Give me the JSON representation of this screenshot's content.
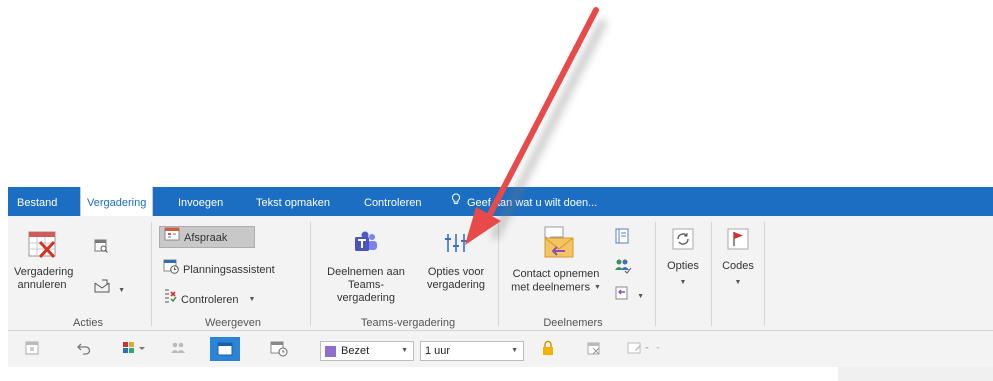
{
  "tabs": {
    "bestand": "Bestand",
    "vergadering": "Vergadering",
    "invoegen": "Invoegen",
    "tekst_opmaken": "Tekst opmaken",
    "controleren": "Controleren",
    "tell_me": "Geef aan wat u wilt doen..."
  },
  "acties": {
    "cancel_line1": "Vergadering",
    "cancel_line2": "annuleren",
    "group_label": "Acties"
  },
  "weergeven": {
    "afspraak": "Afspraak",
    "planningsassistent": "Planningsassistent",
    "controleren": "Controleren",
    "group_label": "Weergeven"
  },
  "teams": {
    "join_line1": "Deelnemen aan",
    "join_line2": "Teams-vergadering",
    "options_line1": "Opties voor",
    "options_line2": "vergadering",
    "group_label": "Teams-vergadering"
  },
  "deelnemers": {
    "contact_line1": "Contact opnemen",
    "contact_line2": "met deelnemers",
    "group_label": "Deelnemers"
  },
  "opties": {
    "label": "Opties"
  },
  "codes": {
    "label": "Codes"
  },
  "quick_access": {
    "show_as": "Bezet",
    "reminder": "1 uur"
  },
  "colors": {
    "ribbon_blue": "#1b6ec2",
    "arrow_red": "#e84a4a",
    "bezet_purple": "#8e6fd0"
  }
}
